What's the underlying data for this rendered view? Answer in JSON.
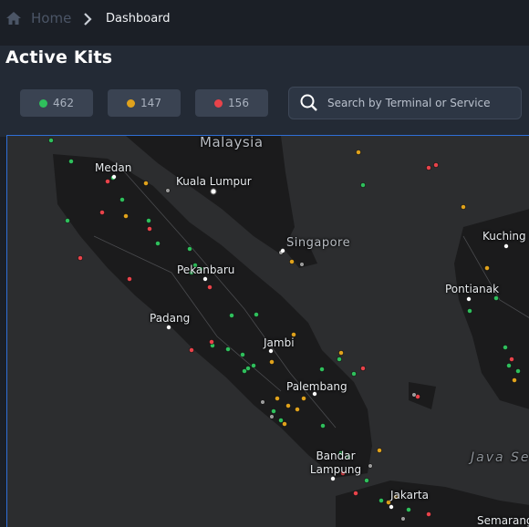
{
  "breadcrumb": {
    "home_label": "Home",
    "current_label": "Dashboard"
  },
  "page": {
    "title": "Active Kits"
  },
  "status_filters": [
    {
      "name": "green",
      "count": "462",
      "color": "#2fbf5c"
    },
    {
      "name": "orange",
      "count": "147",
      "color": "#e0a21c"
    },
    {
      "name": "red",
      "count": "156",
      "color": "#e8434a"
    }
  ],
  "search": {
    "placeholder": "Search by Terminal or Service"
  },
  "map": {
    "labels": {
      "malaysia": "Malaysia",
      "medan": "Medan",
      "kuala_lumpur": "Kuala Lumpur",
      "singapore": "Singapore",
      "kuching": "Kuching",
      "pekanbaru": "Pekanbaru",
      "pontianak": "Pontianak",
      "padang": "Padang",
      "jambi": "Jambi",
      "palembang": "Palembang",
      "bandar_lampung": "Bandar Lampung",
      "jakarta": "Jakarta",
      "java_sea": "Java Sea",
      "semarang": "Semarang"
    }
  }
}
